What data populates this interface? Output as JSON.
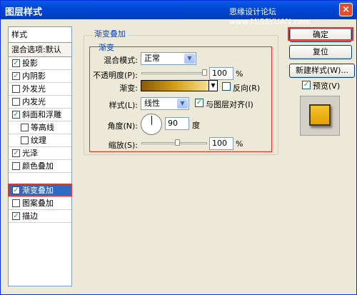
{
  "window": {
    "title": "图层样式",
    "watermark": "思缘设计论坛 www.MISSYUAN.com",
    "close_icon": "×"
  },
  "sidebar": {
    "header": "样式",
    "blend_options": "混合选项:默认",
    "items": [
      {
        "label": "投影",
        "checked": true
      },
      {
        "label": "内阴影",
        "checked": true
      },
      {
        "label": "外发光",
        "checked": false
      },
      {
        "label": "内发光",
        "checked": false
      },
      {
        "label": "斜面和浮雕",
        "checked": true
      },
      {
        "label": "等高线",
        "checked": false
      },
      {
        "label": "纹理",
        "checked": false
      },
      {
        "label": "光泽",
        "checked": true
      },
      {
        "label": "颜色叠加",
        "checked": false
      },
      {
        "label": "渐变叠加",
        "checked": true,
        "selected": true
      },
      {
        "label": "图案叠加",
        "checked": false
      },
      {
        "label": "描边",
        "checked": true
      }
    ],
    "check_mark": "✓"
  },
  "panel": {
    "group_title": "渐变叠加",
    "subgroup_title": "渐变",
    "blend_mode_label": "混合模式:",
    "blend_mode_value": "正常",
    "opacity_label": "不透明度(P):",
    "opacity_value": "100",
    "opacity_unit": "%",
    "opacity_level": 1.0,
    "gradient_label": "渐变:",
    "gradient_colors": [
      "#8a5a00",
      "#d4a010",
      "#f6e090"
    ],
    "reverse_label": "反向(R)",
    "reverse_checked": false,
    "style_label": "样式(L):",
    "style_value": "线性",
    "align_label": "与图层对齐(I)",
    "align_checked": true,
    "angle_label": "角度(N):",
    "angle_value": "90",
    "angle_unit": "度",
    "scale_label": "缩放(S):",
    "scale_value": "100",
    "scale_unit": "%",
    "scale_level": 0.55,
    "dropdown_arrow": "▼"
  },
  "buttons": {
    "ok": "确定",
    "reset": "复位",
    "new_style": "新建样式(W)...",
    "preview_label": "预览(V)",
    "preview_checked": true
  }
}
